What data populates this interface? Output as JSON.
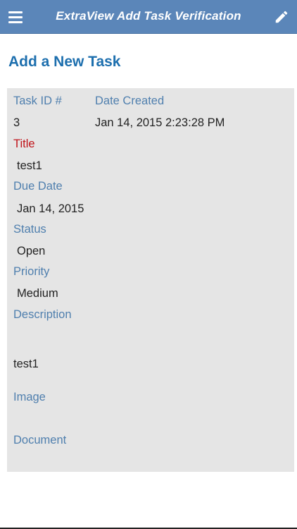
{
  "header": {
    "title": "ExtraView Add Task Verification",
    "menu_icon": "hamburger-menu-icon",
    "edit_icon": "pencil-icon",
    "bar_color": "#5b86b9"
  },
  "page": {
    "title": "Add a New Task"
  },
  "task": {
    "task_id_label": "Task ID #",
    "task_id": "3",
    "date_created_label": "Date Created",
    "date_created": "Jan 14, 2015 2:23:28 PM",
    "title_label": "Title",
    "title": "test1",
    "due_date_label": "Due Date",
    "due_date": "Jan 14, 2015",
    "status_label": "Status",
    "status": "Open",
    "priority_label": "Priority",
    "priority": "Medium",
    "description_label": "Description",
    "description": "test1",
    "image_label": "Image",
    "document_label": "Document"
  },
  "colors": {
    "label": "#4f7fae",
    "required_label": "#c0141a",
    "page_title": "#1d6fae",
    "panel_bg": "#e5e5e5"
  }
}
